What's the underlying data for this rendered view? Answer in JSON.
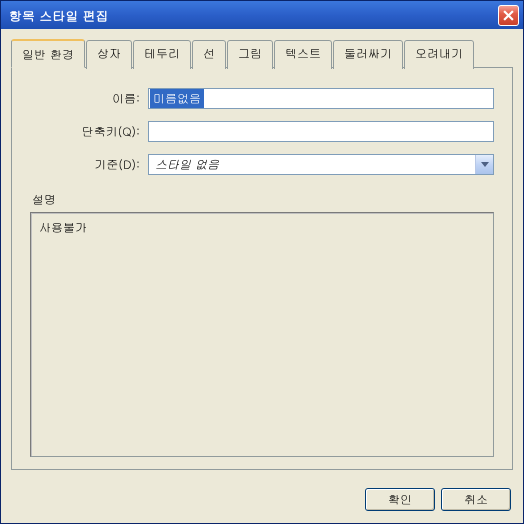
{
  "window": {
    "title": "항목 스타일 편집"
  },
  "tabs": [
    {
      "label": "일반 환경",
      "active": true
    },
    {
      "label": "상자"
    },
    {
      "label": "테두리"
    },
    {
      "label": "선"
    },
    {
      "label": "그림"
    },
    {
      "label": "텍스트"
    },
    {
      "label": "둘러싸기"
    },
    {
      "label": "오려내기"
    }
  ],
  "form": {
    "name_label": "이름:",
    "name_value": "미름없음",
    "shortcut_label": "단축키(Q):",
    "shortcut_value": "",
    "base_label": "기준(D):",
    "base_value": "스타일 없음"
  },
  "description": {
    "label": "설명",
    "text": "사용불가"
  },
  "buttons": {
    "ok": "확인",
    "cancel": "취소"
  }
}
